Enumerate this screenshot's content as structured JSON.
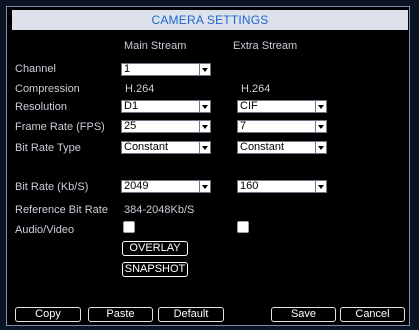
{
  "dialog": {
    "title": "CAMERA SETTINGS",
    "columns": {
      "main": "Main Stream",
      "extra": "Extra Stream"
    }
  },
  "fields": {
    "channel": {
      "label": "Channel",
      "value": "1"
    },
    "compression": {
      "label": "Compression",
      "main": "H.264",
      "extra": "H.264"
    },
    "resolution": {
      "label": "Resolution",
      "main": "D1",
      "extra": "CIF"
    },
    "frame_rate": {
      "label": "Frame Rate (FPS)",
      "main": "25",
      "extra": "7"
    },
    "bit_rate_type": {
      "label": "Bit Rate Type",
      "main": "Constant",
      "extra": "Constant"
    },
    "bit_rate": {
      "label": "Bit Rate (Kb/S)",
      "main": "2049",
      "extra": "160"
    },
    "reference_bit_rate": {
      "label": "Reference Bit Rate",
      "value": "384-2048Kb/S"
    },
    "audio_video": {
      "label": "Audio/Video",
      "main_checked": false,
      "extra_checked": false
    }
  },
  "buttons": {
    "overlay": "OVERLAY",
    "snapshot": "SNAPSHOT",
    "copy": "Copy",
    "paste": "Paste",
    "default": "Default",
    "save": "Save",
    "cancel": "Cancel"
  },
  "colors": {
    "title_text": "#1e66cc",
    "title_bar": "#dde2ea",
    "background": "#000000",
    "text": "#c9ced8"
  }
}
